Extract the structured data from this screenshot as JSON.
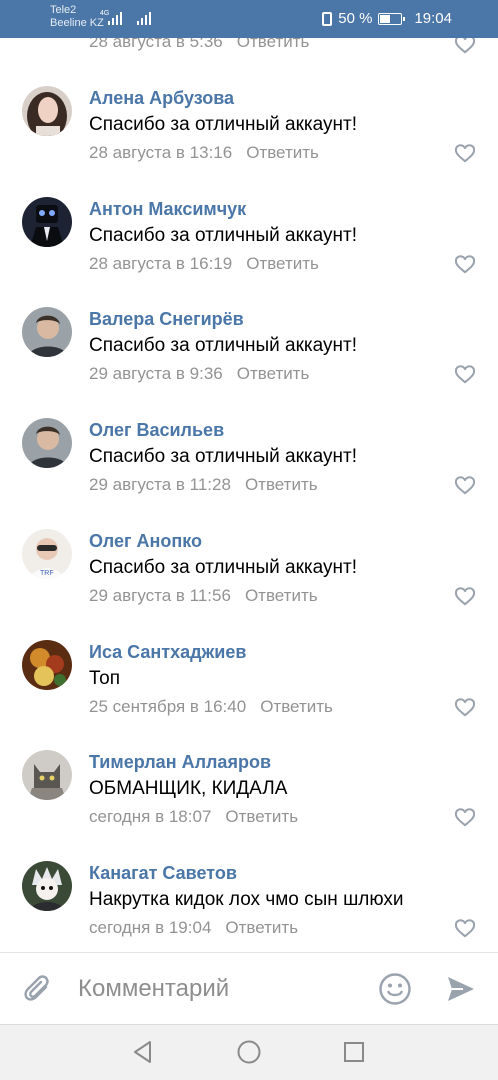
{
  "status_bar": {
    "carrier1": "Tele2",
    "carrier2": "Beeline KZ",
    "network": "4G",
    "battery": "50 %",
    "battery_level": 0.5,
    "time": "19:04"
  },
  "colors": {
    "accent": "#4a76a8",
    "name": "#4a76a8",
    "meta": "#939393",
    "icon": "#99a2ad"
  },
  "partial_comment": {
    "date": "28 августа в 5:36",
    "reply": "Ответить"
  },
  "comments": [
    {
      "name": "Алена Арбузова",
      "text": "Спасибо за отличный аккаунт!",
      "date": "28 августа в 13:16",
      "reply": "Ответить",
      "avatar": "avatar-woman"
    },
    {
      "name": "Антон Максимчук",
      "text": "Спасибо за отличный аккаунт!",
      "date": "28 августа в 16:19",
      "reply": "Ответить",
      "avatar": "avatar-dark"
    },
    {
      "name": "Валера Снегирёв",
      "text": "Спасибо за отличный аккаунт!",
      "date": "29 августа в 9:36",
      "reply": "Ответить",
      "avatar": "avatar-man"
    },
    {
      "name": "Олег Васильев",
      "text": "Спасибо за отличный аккаунт!",
      "date": "29 августа в 11:28",
      "reply": "Ответить",
      "avatar": "avatar-man"
    },
    {
      "name": "Олег Анопко",
      "text": "Спасибо за отличный аккаунт!",
      "date": "29 августа в 11:56",
      "reply": "Ответить",
      "avatar": "avatar-light"
    },
    {
      "name": "Иса Сантхаджиев",
      "text": "Топ",
      "date": "25 сентября в 16:40",
      "reply": "Ответить",
      "avatar": "avatar-colorful"
    },
    {
      "name": "Тимерлан Аллаяров",
      "text": "ОБМАНЩИК, КИДАЛА",
      "date": "сегодня в 18:07",
      "reply": "Ответить",
      "avatar": "avatar-cat"
    },
    {
      "name": "Канагат Саветов",
      "text": "Накрутка кидок лох чмо сын шлюхи",
      "date": "сегодня в 19:04",
      "reply": "Ответить",
      "avatar": "avatar-anime"
    }
  ],
  "input_bar": {
    "placeholder": "Комментарий",
    "attach_icon": "paperclip-icon",
    "emoji_icon": "smile-icon",
    "send_icon": "send-icon"
  },
  "nav_bar": {
    "back_icon": "back-triangle-icon",
    "home_icon": "home-circle-icon",
    "recents_icon": "recents-square-icon"
  }
}
